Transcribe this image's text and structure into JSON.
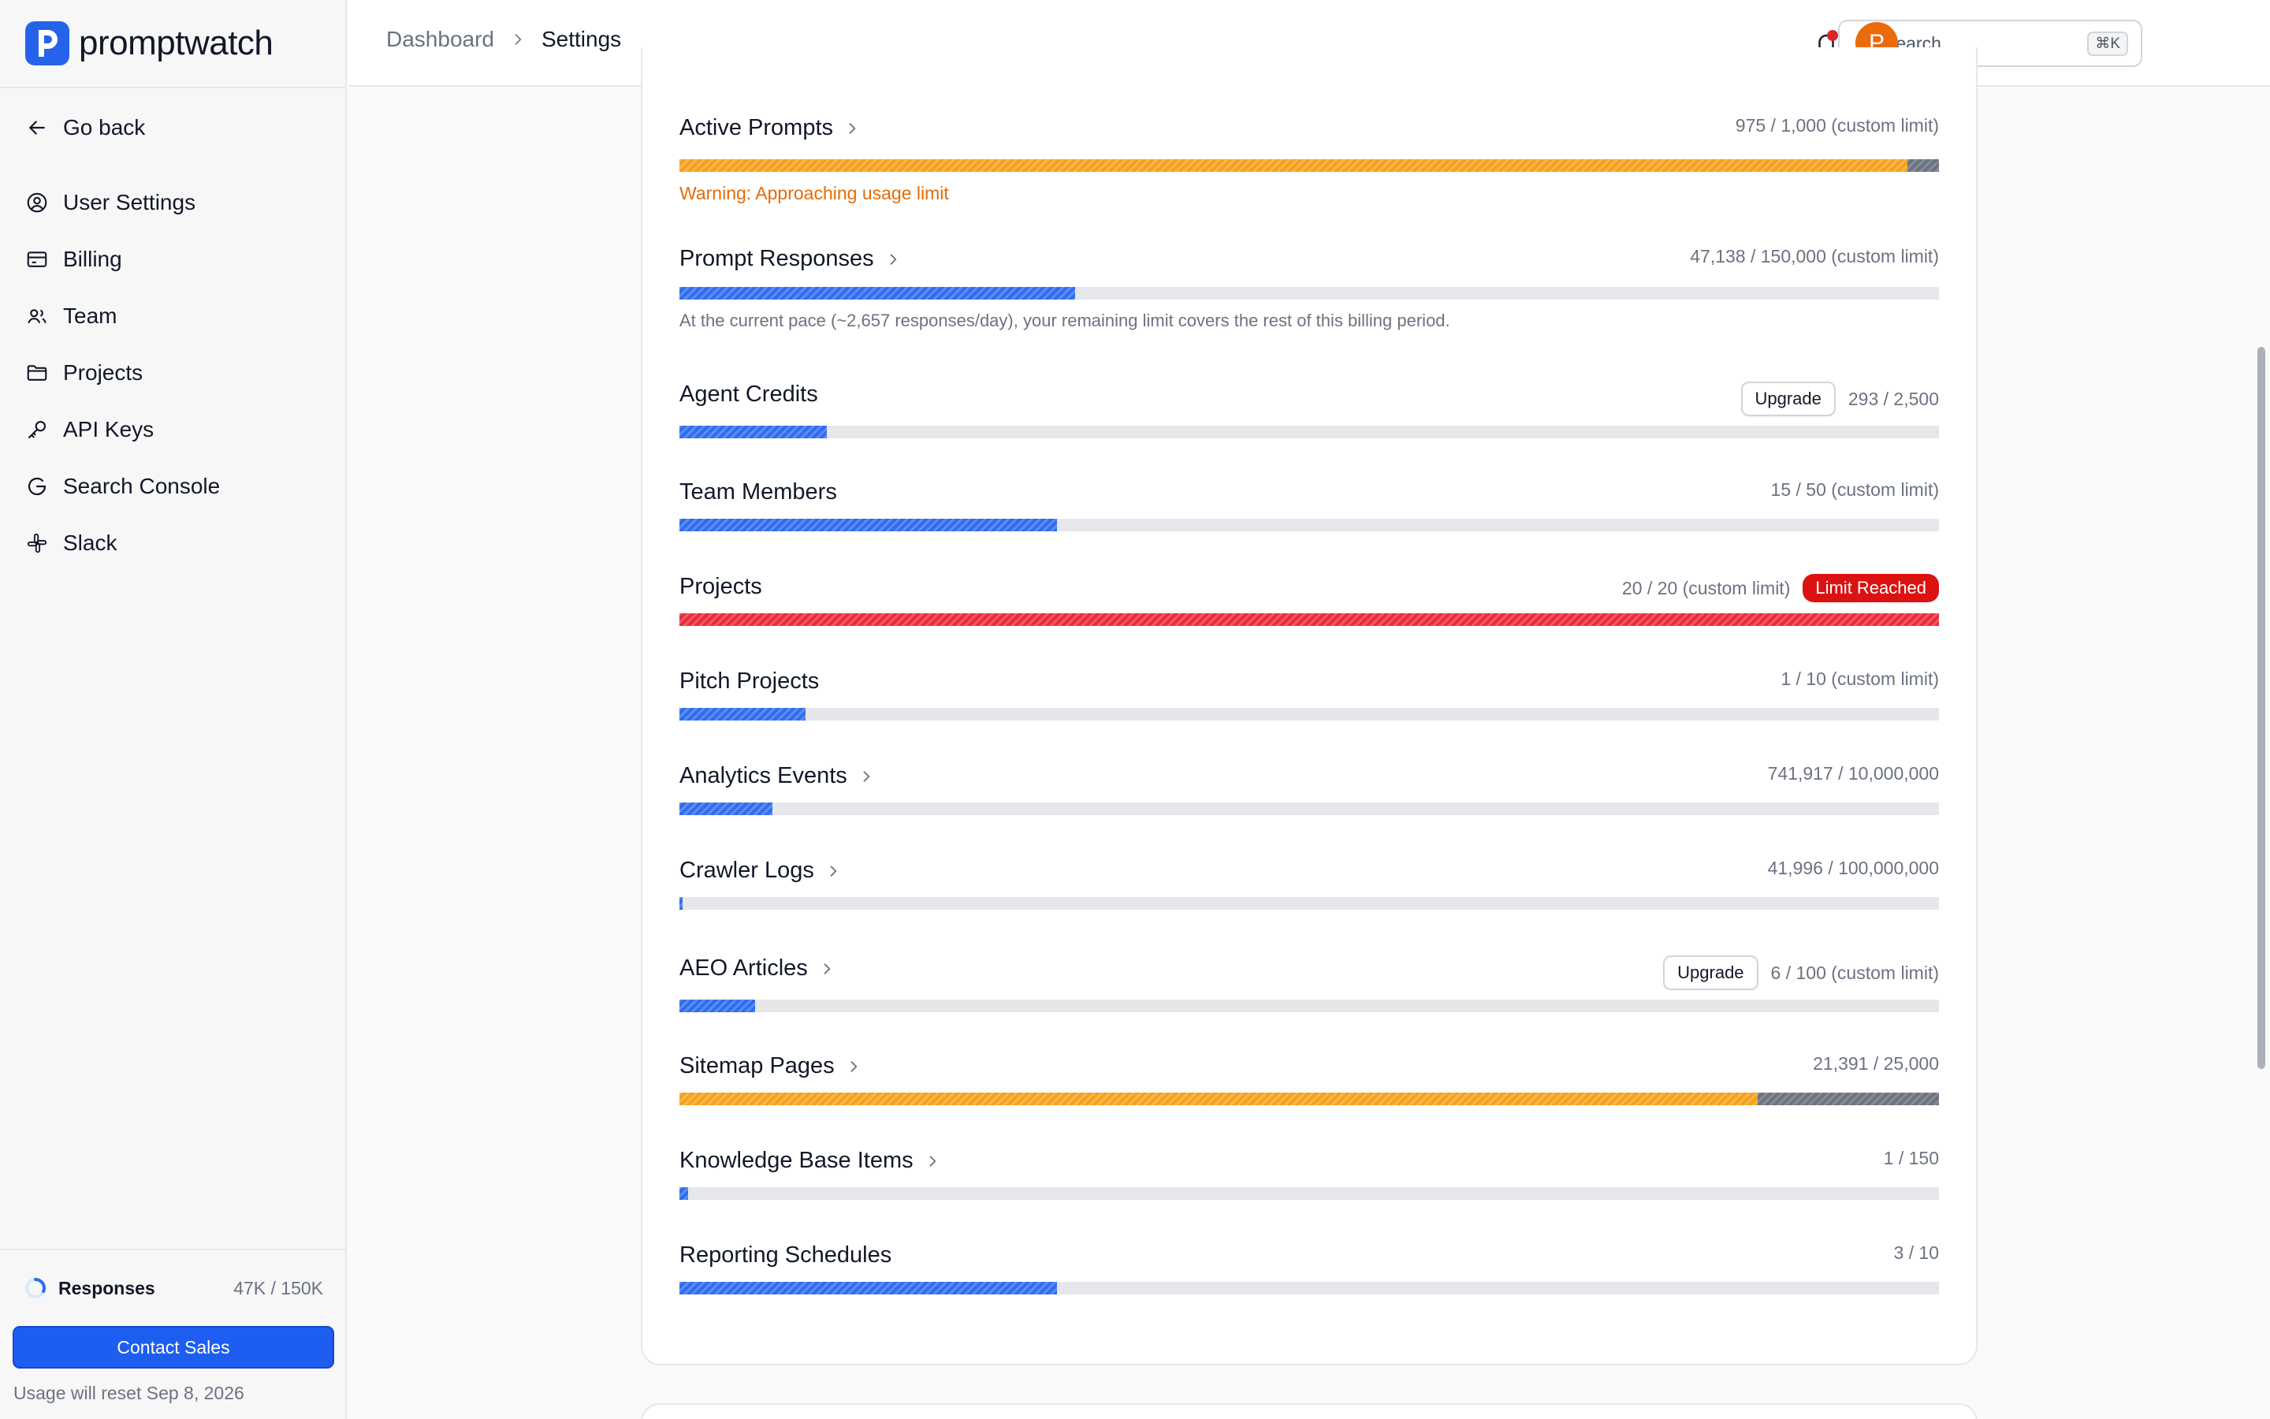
{
  "brand": {
    "name": "promptwatch",
    "color": "#2563eb"
  },
  "sidebar": {
    "back_label": "Go back",
    "items": [
      {
        "label": "User Settings",
        "icon": "user-circle-icon"
      },
      {
        "label": "Billing",
        "icon": "credit-card-icon"
      },
      {
        "label": "Team",
        "icon": "users-icon"
      },
      {
        "label": "Projects",
        "icon": "folder-icon"
      },
      {
        "label": "API Keys",
        "icon": "key-icon"
      },
      {
        "label": "Search Console",
        "icon": "google-icon"
      },
      {
        "label": "Slack",
        "icon": "slack-icon"
      }
    ],
    "usage": {
      "label": "Responses",
      "value": "47K / 150K",
      "progress": 0.31
    },
    "contact_label": "Contact Sales",
    "reset_text": "Usage will reset Sep 8, 2026"
  },
  "header": {
    "breadcrumb": {
      "root": "Dashboard",
      "current": "Settings"
    },
    "search": {
      "placeholder": "Search...",
      "shortcut": "⌘K"
    },
    "avatar_initial": "P"
  },
  "usage_rows": [
    {
      "title": "Active Prompts",
      "has_chevron": true,
      "value_text": "975 / 1,000 (custom limit)",
      "color": "orange",
      "fill": 0.975,
      "warning": "Warning: Approaching usage limit"
    },
    {
      "title": "Prompt Responses",
      "has_chevron": true,
      "value_text": "47,138 / 150,000 (custom limit)",
      "color": "blue",
      "fill": 0.314,
      "note": "At the current pace (~2,657 responses/day), your remaining limit covers the rest of this billing period."
    },
    {
      "title": "Agent Credits",
      "has_chevron": false,
      "value_text": "293 / 2,500",
      "upgrade_label": "Upgrade",
      "color": "blue",
      "fill": 0.117
    },
    {
      "title": "Team Members",
      "has_chevron": false,
      "value_text": "15 / 50 (custom limit)",
      "color": "blue",
      "fill": 0.3
    },
    {
      "title": "Projects",
      "has_chevron": false,
      "value_text": "20 / 20 (custom limit)",
      "badge": "Limit Reached",
      "color": "red",
      "fill": 1.0
    },
    {
      "title": "Pitch Projects",
      "has_chevron": false,
      "value_text": "1 / 10 (custom limit)",
      "color": "blue",
      "fill": 0.1
    },
    {
      "title": "Analytics Events",
      "has_chevron": true,
      "value_text": "741,917 / 10,000,000",
      "color": "blue",
      "fill": 0.074
    },
    {
      "title": "Crawler Logs",
      "has_chevron": true,
      "value_text": "41,996 / 100,000,000",
      "color": "blue",
      "fill": 0.0004
    },
    {
      "title": "AEO Articles",
      "has_chevron": true,
      "value_text": "6 / 100 (custom limit)",
      "upgrade_label": "Upgrade",
      "color": "blue",
      "fill": 0.06
    },
    {
      "title": "Sitemap Pages",
      "has_chevron": true,
      "value_text": "21,391 / 25,000",
      "color": "orange",
      "fill": 0.856
    },
    {
      "title": "Knowledge Base Items",
      "has_chevron": true,
      "value_text": "1 / 150",
      "color": "blue",
      "fill": 0.0067
    },
    {
      "title": "Reporting Schedules",
      "has_chevron": false,
      "value_text": "3 / 10",
      "color": "blue",
      "fill": 0.3
    }
  ]
}
